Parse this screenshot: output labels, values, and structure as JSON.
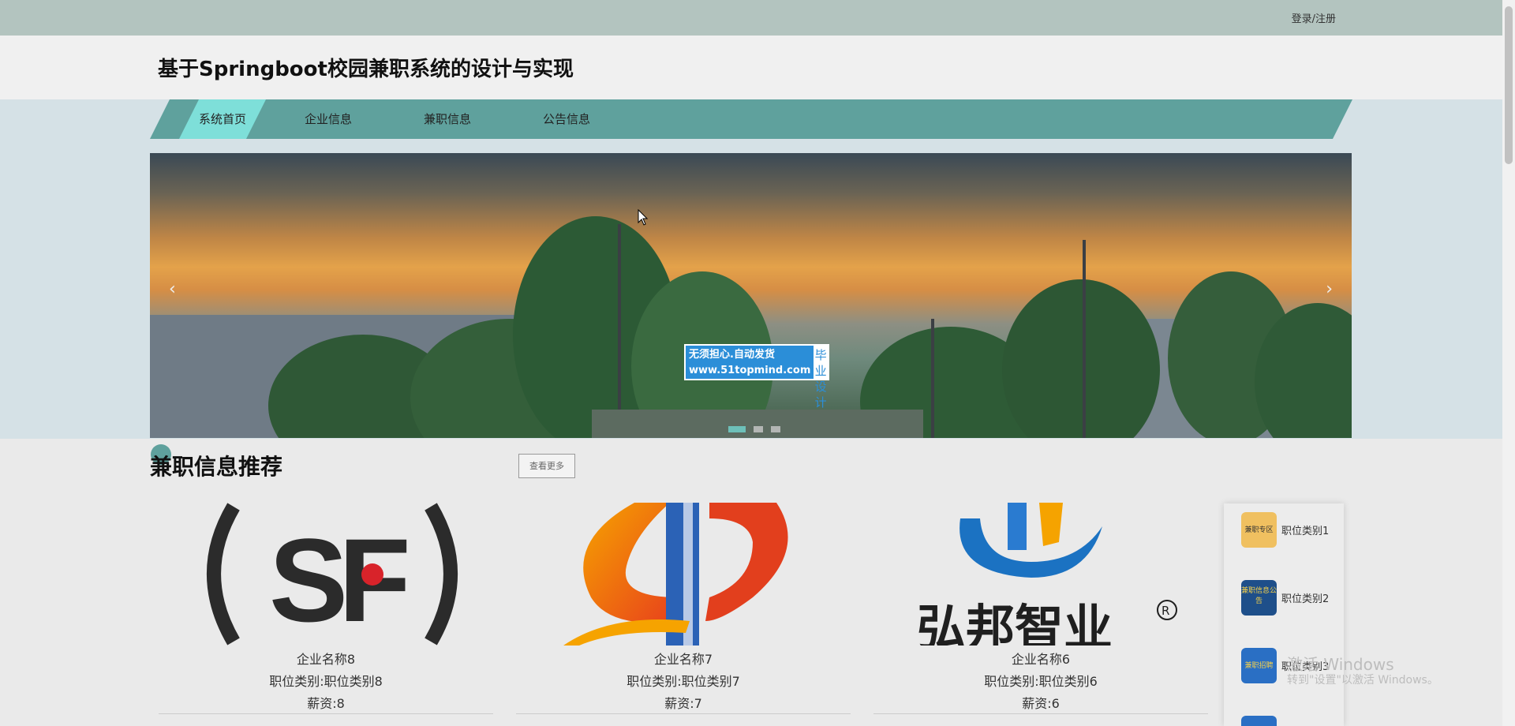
{
  "topbar": {
    "login_label": "登录/注册"
  },
  "header": {
    "title": "基于Springboot校园兼职系统的设计与实现"
  },
  "nav": {
    "items": [
      {
        "label": "系统首页",
        "active": true
      },
      {
        "label": "企业信息",
        "active": false
      },
      {
        "label": "兼职信息",
        "active": false
      },
      {
        "label": "公告信息",
        "active": false
      }
    ]
  },
  "banner": {
    "prev_icon": "chevron-left-icon",
    "next_icon": "chevron-right-icon",
    "watermark": {
      "line1": "无须担心.自动发货",
      "line2": "www.51topmind.com",
      "badge": "毕业设计"
    },
    "slides": 3,
    "active_slide": 1
  },
  "section": {
    "title": "兼职信息推荐",
    "more_label": "查看更多"
  },
  "cards": [
    {
      "company": "企业名称8",
      "category": "职位类别:职位类别8",
      "salary": "薪资:8",
      "logo": "SF"
    },
    {
      "company": "企业名称7",
      "category": "职位类别:职位类别7",
      "salary": "薪资:7",
      "logo": "orange-swirl"
    },
    {
      "company": "企业名称6",
      "category": "职位类别:职位类别6",
      "salary": "薪资:6",
      "logo": "弘邦智业"
    }
  ],
  "sidebar": {
    "items": [
      {
        "label": "职位类别1",
        "color": "#f0c060"
      },
      {
        "label": "职位类别2",
        "color": "#1e4f8a"
      },
      {
        "label": "职位类别3",
        "color": "#2a6fc4"
      },
      {
        "label": "",
        "color": "#2a6fc4"
      }
    ]
  },
  "thumb_texts": {
    "t1": "兼职专区",
    "t2": "兼职信息公告",
    "t3": "兼职招聘"
  },
  "windows_activation": {
    "line1": "激活 Windows",
    "line2": "转到\"设置\"以激活 Windows。"
  },
  "colors": {
    "topbar": "#b3c4bf",
    "nav": "#5fa19d",
    "nav_active": "#7edfd9"
  }
}
